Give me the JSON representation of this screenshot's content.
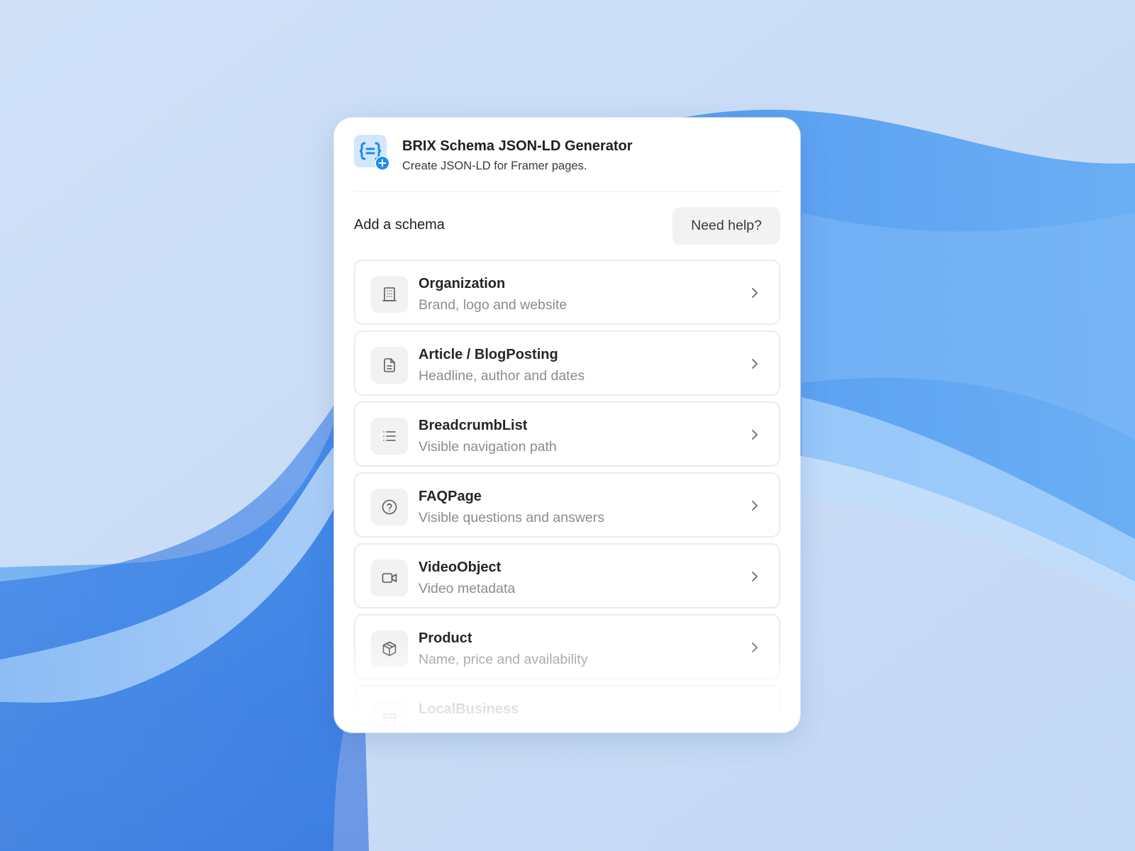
{
  "app": {
    "title": "BRIX Schema JSON-LD Generator",
    "subtitle": "Create JSON-LD for Framer pages.",
    "icon": "curly-braces-equals-icon",
    "badge_icon": "plus-circle-icon",
    "accent_color": "#1a8cf0"
  },
  "section": {
    "title": "Add a schema",
    "help_label": "Need help?"
  },
  "schemas": [
    {
      "title": "Organization",
      "description": "Brand, logo and website",
      "icon": "building-icon"
    },
    {
      "title": "Article / BlogPosting",
      "description": "Headline, author and dates",
      "icon": "document-icon"
    },
    {
      "title": "BreadcrumbList",
      "description": "Visible navigation path",
      "icon": "list-icon"
    },
    {
      "title": "FAQPage",
      "description": "Visible questions and answers",
      "icon": "question-circle-icon"
    },
    {
      "title": "VideoObject",
      "description": "Video metadata",
      "icon": "video-camera-icon"
    },
    {
      "title": "Product",
      "description": "Name, price and availability",
      "icon": "box-icon"
    },
    {
      "title": "LocalBusiness",
      "description": "",
      "icon": "store-icon"
    }
  ]
}
